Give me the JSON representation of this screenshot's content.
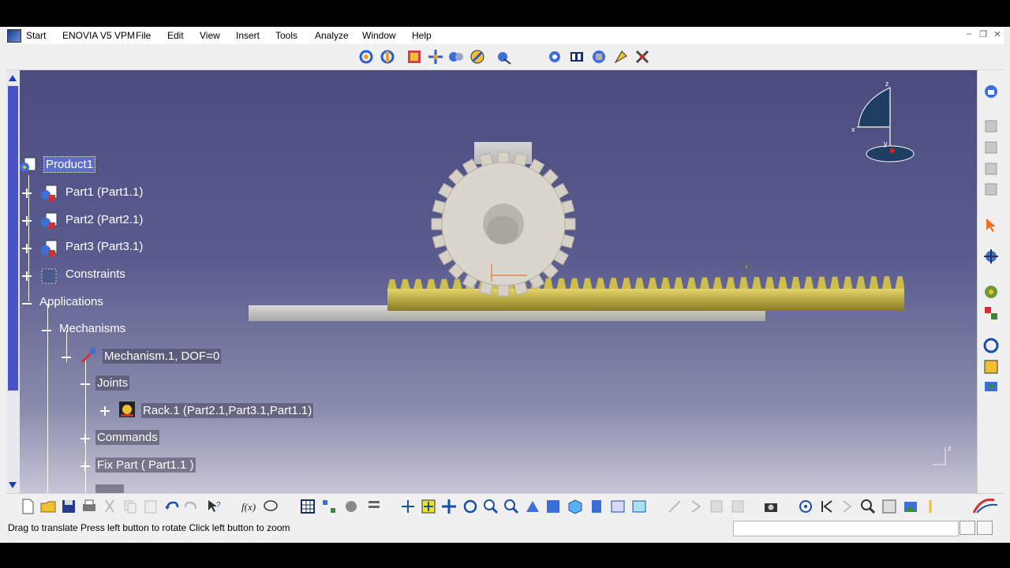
{
  "menu": {
    "start": "Start",
    "enovia": "ENOVIA V5 VPM",
    "file": "File",
    "edit": "Edit",
    "view": "View",
    "insert": "Insert",
    "tools": "Tools",
    "analyze": "Analyze",
    "window": "Window",
    "help": "Help"
  },
  "window_controls": {
    "minimize": "‒",
    "restore": "❐",
    "close": "✕"
  },
  "tree": {
    "root": "Product1",
    "part1": "Part1 (Part1.1)",
    "part2": "Part2 (Part2.1)",
    "part3": "Part3 (Part3.1)",
    "constraints": "Constraints",
    "applications": "Applications",
    "mechanisms": "Mechanisms",
    "mechanism": "Mechanism.1, DOF=0",
    "joints": "Joints",
    "rack": "Rack.1 (Part2.1,Part3.1,Part1.1)",
    "commands": "Commands",
    "fix_part": "Fix Part ( Part1.1 )"
  },
  "compass": {
    "x": "x",
    "y": "y",
    "z": "z"
  },
  "status": {
    "message": "Drag to translate  Press left button to rotate  Click left button to zoom",
    "command_input": ""
  },
  "colors": {
    "viewport_top": "#4b4d80",
    "viewport_bottom": "#c6c6d6",
    "selection": "#5d6dc8",
    "gear": "#d9d4cc",
    "rack": "#b8a53a",
    "scroll_thumb": "#4a52c8"
  },
  "icons": {
    "top_toolbar": [
      "rotate-icon",
      "rotate-alt-icon",
      "assembly-icon",
      "explode-icon",
      "manipulate-icon",
      "snap-icon",
      "clash-icon",
      "fix-icon",
      "simulation-icon",
      "joint-icon",
      "sensor-icon",
      "speed-icon",
      "tools-icon"
    ],
    "bottom_toolbar": [
      "new-icon",
      "open-icon",
      "save-icon",
      "print-icon",
      "cut-icon",
      "copy-icon",
      "paste-icon",
      "undo-icon",
      "redo-icon",
      "whats-this-icon",
      "formula-icon",
      "comment-icon",
      "pan-icon",
      "fit-all-icon",
      "pan-move-icon",
      "rotate-view-icon",
      "zoom-in-icon",
      "zoom-out-icon",
      "normal-view-icon",
      "views-icon",
      "render-icon",
      "hide-show-icon",
      "swap-icon",
      "capture-icon"
    ]
  }
}
